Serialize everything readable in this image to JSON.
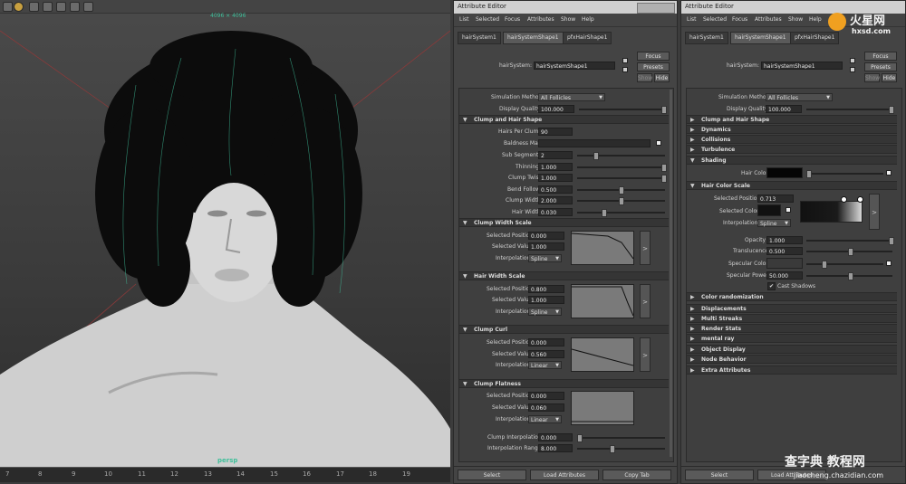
{
  "viewport": {
    "resolution_label": "4096 × 4096",
    "camera_label": "persp",
    "ruler_ticks": [
      "7",
      "8",
      "9",
      "10",
      "11",
      "12",
      "13",
      "14",
      "15",
      "16",
      "17",
      "18",
      "19"
    ]
  },
  "panel1": {
    "title": "Attribute Editor",
    "menu": [
      "List",
      "Selected",
      "Focus",
      "Attributes",
      "Show",
      "Help"
    ],
    "tabs": [
      "hairSystem1",
      "hairSystemShape1",
      "pfxHairShape1"
    ],
    "node_label": "hairSystem:",
    "node_value": "hairSystemShape1",
    "focus_btn": "Focus",
    "presets_btn": "Presets",
    "show_btn": "Show",
    "hide_btn": "Hide",
    "simulation_method_label": "Simulation Method",
    "simulation_method_value": "All Follicles",
    "display_quality_label": "Display Quality",
    "display_quality_value": "100.000",
    "clump_section": "Clump and Hair Shape",
    "hairs_per_clump_label": "Hairs Per Clump",
    "hairs_per_clump_value": "90",
    "baldness_map_label": "Baldness Map",
    "sub_segments_label": "Sub Segments",
    "sub_segments_value": "2",
    "thinning_label": "Thinning",
    "thinning_value": "1.000",
    "clump_twist_label": "Clump Twist",
    "clump_twist_value": "1.000",
    "bend_follow_label": "Bend Follow",
    "bend_follow_value": "0.500",
    "clump_width_label": "Clump Width",
    "clump_width_value": "2.000",
    "hair_width_label": "Hair Width",
    "hair_width_value": "0.030",
    "cws_section": "Clump Width Scale",
    "cws_pos_label": "Selected Position",
    "cws_pos_value": "0.000",
    "cws_val_label": "Selected Value",
    "cws_val_value": "1.000",
    "cws_interp_label": "Interpolation",
    "cws_interp_value": "Spline",
    "hws_section": "Hair Width Scale",
    "hws_pos_label": "Selected Position",
    "hws_pos_value": "0.800",
    "hws_val_label": "Selected Value",
    "hws_val_value": "1.000",
    "hws_interp_label": "Interpolation",
    "hws_interp_value": "Spline",
    "cc_section": "Clump Curl",
    "cc_pos_label": "Selected Position",
    "cc_pos_value": "0.000",
    "cc_val_label": "Selected Value",
    "cc_val_value": "0.560",
    "cc_interp_label": "Interpolation",
    "cc_interp_value": "Linear",
    "cf_section": "Clump Flatness",
    "cf_pos_label": "Selected Position",
    "cf_pos_value": "0.000",
    "cf_val_label": "Selected Value",
    "cf_val_value": "0.060",
    "cf_interp_label": "Interpolation",
    "cf_interp_value": "Linear",
    "clump_interp_label": "Clump Interpolation",
    "clump_interp_value": "0.000",
    "interp_range_label": "Interpolation Range",
    "interp_range_value": "8.000",
    "expand_glyph": ">",
    "bottom": [
      "Select",
      "Load Attributes",
      "Copy Tab"
    ]
  },
  "panel2": {
    "title": "Attribute Editor",
    "menu": [
      "List",
      "Selected",
      "Focus",
      "Attributes",
      "Show",
      "Help"
    ],
    "tabs": [
      "hairSystem1",
      "hairSystemShape1",
      "pfxHairShape1"
    ],
    "node_label": "hairSystem:",
    "node_value": "hairSystemShape1",
    "focus_btn": "Focus",
    "presets_btn": "Presets",
    "show_btn": "Show",
    "hide_btn": "Hide",
    "simulation_method_label": "Simulation Method",
    "simulation_method_value": "All Follicles",
    "display_quality_label": "Display Quality",
    "display_quality_value": "100.000",
    "collapsed_top": [
      "Clump and Hair Shape",
      "Dynamics",
      "Collisions",
      "Turbulence"
    ],
    "shading_section": "Shading",
    "hair_color_label": "Hair Color",
    "hcs_section": "Hair Color Scale",
    "hcs_pos_label": "Selected Position",
    "hcs_pos_value": "0.713",
    "hcs_color_label": "Selected Color",
    "hcs_interp_label": "Interpolation",
    "hcs_interp_value": "Spline",
    "opacity_label": "Opacity",
    "opacity_value": "1.000",
    "translucence_label": "Translucence",
    "translucence_value": "0.500",
    "specular_color_label": "Specular Color",
    "specular_power_label": "Specular Power",
    "specular_power_value": "50.000",
    "cast_shadows_label": "Cast Shadows",
    "cast_shadows_mark": "✔",
    "color_random_section": "Color randomization",
    "collapsed_bottom": [
      "Displacements",
      "Multi Streaks",
      "Render Stats",
      "mental ray",
      "Object Display",
      "Node Behavior",
      "Extra Attributes"
    ],
    "expand_glyph": ">",
    "bottom": [
      "Select",
      "Load Attributes"
    ]
  },
  "watermark": {
    "top_brand": "火星网",
    "top_url": "hxsd.com",
    "bottom_brand": "查字典 教程网",
    "bottom_url": "jiaocheng.chazidian.com"
  },
  "colors": {
    "accent_green": "#3fbf9a",
    "hair_color": "#050505"
  }
}
